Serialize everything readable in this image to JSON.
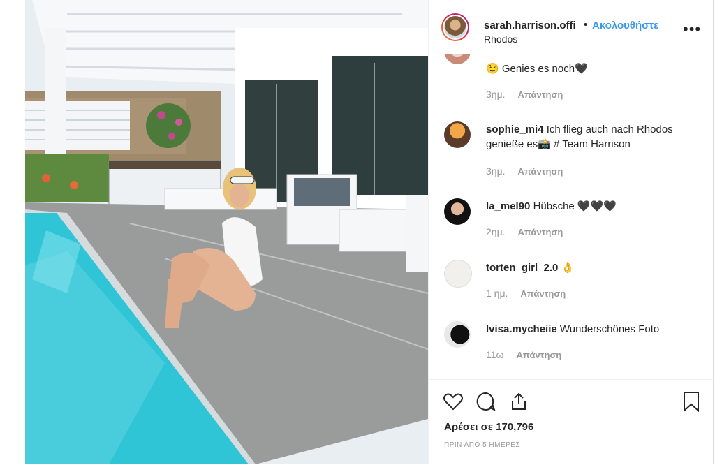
{
  "post": {
    "username": "sarah.harrison.offi",
    "separator": "•",
    "follow_label": "Ακολουθήστε",
    "location": "Rhodos",
    "more_icon": "ellipsis-icon"
  },
  "comments": [
    {
      "user": "",
      "text": "😉 Genies es noch🖤",
      "time": "3ημ.",
      "reply": "Απάντηση"
    },
    {
      "user": "sophie_mi4",
      "text": "Ich flieg auch nach Rhodos genieße es📸 # Team Harrison",
      "time": "3ημ.",
      "reply": "Απάντηση"
    },
    {
      "user": "la_mel90",
      "text": "Hübsche 🖤🖤🖤",
      "time": "2ημ.",
      "reply": "Απάντηση"
    },
    {
      "user": "torten_girl_2.0",
      "text": "👌",
      "time": "1 ημ.",
      "reply": "Απάντηση"
    },
    {
      "user": "lvisa.mycheiie",
      "text": "Wunderschönes Foto",
      "time": "11ω",
      "reply": "Απάντηση"
    }
  ],
  "actions": {
    "like_icon": "heart-icon",
    "comment_icon": "comment-icon",
    "share_icon": "share-icon",
    "save_icon": "bookmark-icon"
  },
  "likes_text": "Αρέσει σε 170,796",
  "timestamp": "ΠΡΙΝ ΑΠΟ 5 ΗΜΕΡΕΣ",
  "colors": {
    "accent": "#3897f0",
    "muted": "#999999",
    "text": "#262626"
  }
}
